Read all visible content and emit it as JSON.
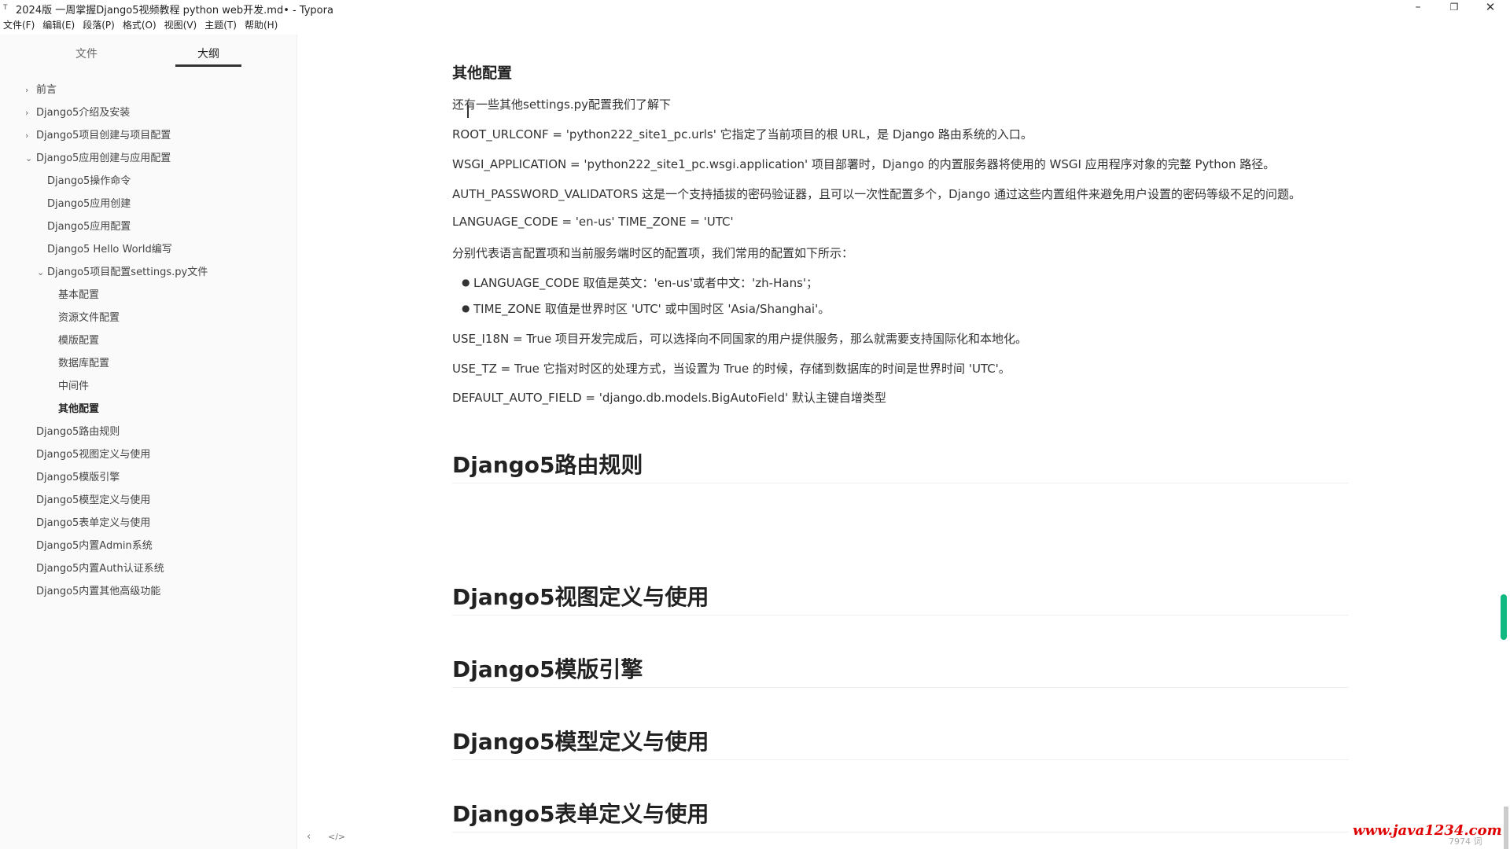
{
  "window": {
    "title": "2024版 一周掌握Django5视频教程 python web开发.md• - Typora",
    "controls": {
      "minimize": "–",
      "maximize": "❐",
      "close": "✕"
    }
  },
  "menu": [
    "文件(F)",
    "编辑(E)",
    "段落(P)",
    "格式(O)",
    "视图(V)",
    "主题(T)",
    "帮助(H)"
  ],
  "sidebar": {
    "tabs": {
      "files": "文件",
      "outline": "大纲"
    },
    "outline_items": [
      {
        "label": "前言",
        "level": 0,
        "caret": "›"
      },
      {
        "label": "Django5介绍及安装",
        "level": 0,
        "caret": "›"
      },
      {
        "label": "Django5项目创建与项目配置",
        "level": 0,
        "caret": "›"
      },
      {
        "label": "Django5应用创建与应用配置",
        "level": 0,
        "caret": "⌄"
      },
      {
        "label": "Django5操作命令",
        "level": 1,
        "caret": ""
      },
      {
        "label": "Django5应用创建",
        "level": 1,
        "caret": ""
      },
      {
        "label": "Django5应用配置",
        "level": 1,
        "caret": ""
      },
      {
        "label": "Django5 Hello World编写",
        "level": 1,
        "caret": ""
      },
      {
        "label": "Django5项目配置settings.py文件",
        "level": 1,
        "caret": "⌄"
      },
      {
        "label": "基本配置",
        "level": 2,
        "caret": ""
      },
      {
        "label": "资源文件配置",
        "level": 2,
        "caret": ""
      },
      {
        "label": "模版配置",
        "level": 2,
        "caret": ""
      },
      {
        "label": "数据库配置",
        "level": 2,
        "caret": ""
      },
      {
        "label": "中间件",
        "level": 2,
        "caret": ""
      },
      {
        "label": "其他配置",
        "level": 2,
        "caret": "",
        "active": true
      },
      {
        "label": "Django5路由规则",
        "level": 0,
        "caret": ""
      },
      {
        "label": "Django5视图定义与使用",
        "level": 0,
        "caret": ""
      },
      {
        "label": "Django5模版引擎",
        "level": 0,
        "caret": ""
      },
      {
        "label": "Django5模型定义与使用",
        "level": 0,
        "caret": ""
      },
      {
        "label": "Django5表单定义与使用",
        "level": 0,
        "caret": ""
      },
      {
        "label": "Django5内置Admin系统",
        "level": 0,
        "caret": ""
      },
      {
        "label": "Django5内置Auth认证系统",
        "level": 0,
        "caret": ""
      },
      {
        "label": "Django5内置其他高级功能",
        "level": 0,
        "caret": ""
      }
    ],
    "footer": {
      "back": "‹",
      "source": "</>"
    }
  },
  "editor": {
    "section_heading": "其他配置",
    "intro": "还有一些其他settings.py配置我们了解下",
    "root_urlconf": "ROOT_URLCONF = 'python222_site1_pc.urls'   它指定了当前项目的根 URL，是 Django 路由系统的入口。",
    "wsgi": "WSGI_APPLICATION = 'python222_site1_pc.wsgi.application'  项目部署时，Django 的内置服务器将使用的 WSGI 应用程序对象的完整 Python 路径。",
    "auth_validators": "AUTH_PASSWORD_VALIDATORS  这是一个支持插拔的密码验证器，且可以一次性配置多个，Django 通过这些内置组件来避免用户设置的密码等级不足的问题。",
    "lang_tz": "LANGUAGE_CODE = 'en-us'   TIME_ZONE = 'UTC'",
    "lang_tz_desc": "分别代表语言配置项和当前服务端时区的配置项，我们常用的配置如下所示：",
    "bullets": [
      "LANGUAGE_CODE 取值是英文：'en-us'或者中文：'zh-Hans'；",
      "TIME_ZONE 取值是世界时区 'UTC' 或中国时区 'Asia/Shanghai'。"
    ],
    "use_i18n": "USE_I18N = True 项目开发完成后，可以选择向不同国家的用户提供服务，那么就需要支持国际化和本地化。",
    "use_tz": "USE_TZ = True  它指对时区的处理方式，当设置为 True 的时候，存储到数据库的时间是世界时间 'UTC'。",
    "default_auto_field": "DEFAULT_AUTO_FIELD = 'django.db.models.BigAutoField'  默认主键自增类型",
    "headings": [
      "Django5路由规则",
      "Django5视图定义与使用",
      "Django5模版引擎",
      "Django5模型定义与使用",
      "Django5表单定义与使用"
    ]
  },
  "status": {
    "word_count": "7974 词"
  },
  "watermark": "www.java1234.com",
  "colors": {
    "accent": "#10b981",
    "spellcheck": "#e53935",
    "watermark": "#e00000"
  }
}
